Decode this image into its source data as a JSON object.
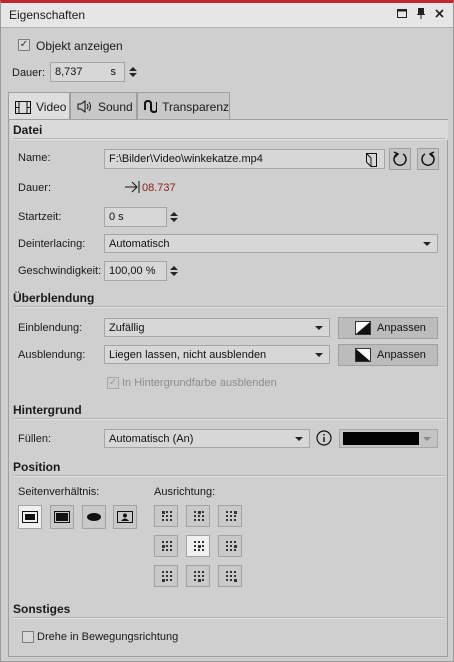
{
  "window": {
    "title": "Eigenschaften",
    "controls": [
      "minimize-icon",
      "pin-icon",
      "close-icon"
    ]
  },
  "top": {
    "show_object_label": "Objekt anzeigen",
    "show_object_checked": true,
    "duration_label": "Dauer:",
    "duration_value": "8,737",
    "duration_unit": "s"
  },
  "tabs": [
    {
      "label": "Video",
      "icon": "film-icon",
      "active": true
    },
    {
      "label": "Sound",
      "icon": "speaker-icon",
      "active": false
    },
    {
      "label": "Transparenz",
      "icon": "transparency-icon",
      "active": false
    }
  ],
  "datei": {
    "heading": "Datei",
    "name_label": "Name:",
    "name_value": "F:\\Bilder\\Video\\winkekatze.mp4",
    "dauer_label": "Dauer:",
    "dauer_value": "08.737",
    "startzeit_label": "Startzeit:",
    "startzeit_value": "0 s",
    "deinterlacing_label": "Deinterlacing:",
    "deinterlacing_value": "Automatisch",
    "speed_label": "Geschwindigkeit:",
    "speed_value": "100,00 %"
  },
  "blend": {
    "heading": "Überblendung",
    "in_label": "Einblendung:",
    "in_value": "Zufällig",
    "out_label": "Ausblendung:",
    "out_value": "Liegen lassen, nicht ausblenden",
    "adjust_label": "Anpassen",
    "bg_fade_label": "In Hintergrundfarbe ausblenden",
    "bg_fade_checked": true
  },
  "background": {
    "heading": "Hintergrund",
    "fill_label": "Füllen:",
    "fill_value": "Automatisch (An)",
    "fill_color": "#000000"
  },
  "position": {
    "heading": "Position",
    "ratio_label": "Seitenverhältnis:",
    "align_label": "Ausrichtung:",
    "ratio_active": 0,
    "align_active": 4
  },
  "misc": {
    "heading": "Sonstiges",
    "rotate_label": "Drehe in Bewegungsrichtung",
    "rotate_checked": false
  },
  "colors": {
    "accent": "#c0282d",
    "duration_value": "#8b1a1a"
  }
}
